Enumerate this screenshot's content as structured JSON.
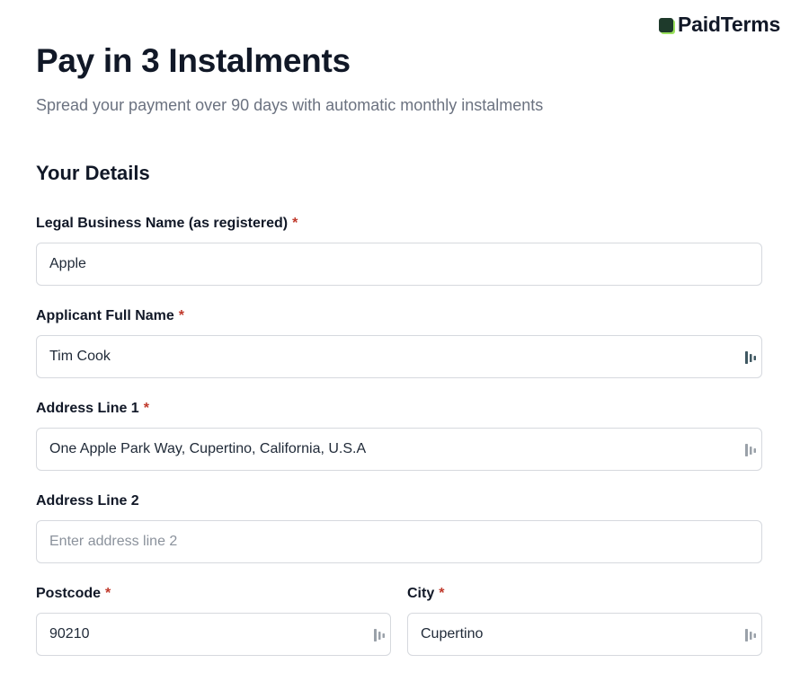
{
  "brand": {
    "name": "PaidTerms"
  },
  "header": {
    "title": "Pay in 3 Instalments",
    "subtitle": "Spread your payment over 90 days with automatic monthly instalments"
  },
  "section": {
    "title": "Your Details"
  },
  "fields": {
    "business_name": {
      "label": "Legal Business Name (as registered)",
      "required_mark": "*",
      "value": "Apple",
      "placeholder": ""
    },
    "applicant_name": {
      "label": "Applicant Full Name",
      "required_mark": "*",
      "value": "Tim Cook",
      "placeholder": ""
    },
    "address_line_1": {
      "label": "Address Line 1",
      "required_mark": "*",
      "value": "One Apple Park Way, Cupertino, California, U.S.A",
      "placeholder": ""
    },
    "address_line_2": {
      "label": "Address Line 2",
      "value": "",
      "placeholder": "Enter address line 2"
    },
    "postcode": {
      "label": "Postcode",
      "required_mark": "*",
      "value": "90210",
      "placeholder": ""
    },
    "city": {
      "label": "City",
      "required_mark": "*",
      "value": "Cupertino",
      "placeholder": ""
    }
  },
  "icons": {
    "autofill": "password-manager-autofill-icon",
    "autofill_active_color": "#3f5862",
    "autofill_idle_color": "#9aa1a9"
  },
  "colors": {
    "required": "#c0392b",
    "brand_mark": "#1e3a2b",
    "brand_accent": "#9be15d"
  }
}
